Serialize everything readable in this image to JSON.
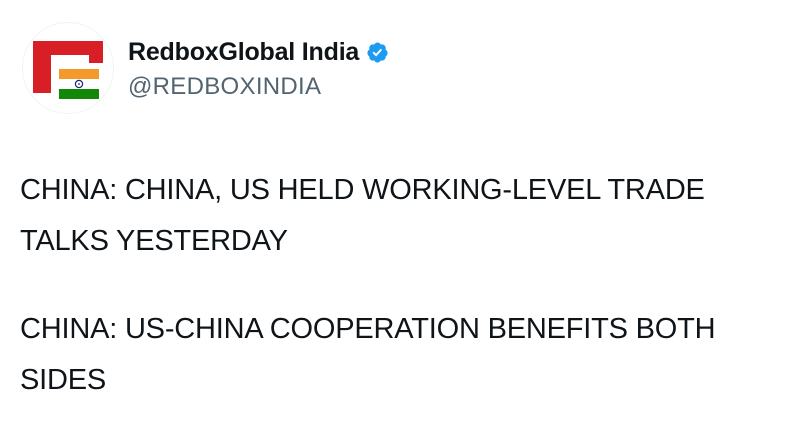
{
  "account": {
    "display_name": "RedboxGlobal India",
    "handle": "@REDBOXINDIA",
    "verified": true,
    "avatar_icon": "redbox-india-logo-icon",
    "verified_icon": "verified-badge-icon"
  },
  "tweet": {
    "paragraphs": [
      "CHINA: CHINA, US HELD WORKING-LEVEL TRADE TALKS YESTERDAY",
      "CHINA: US-CHINA COOPERATION BENEFITS BOTH SIDES"
    ]
  },
  "colors": {
    "brand_red": "#d91f26",
    "verified_blue": "#1d9bf0",
    "handle_gray": "#536471",
    "text": "#0f1419",
    "saffron": "#f39a2a",
    "green": "#138808"
  }
}
